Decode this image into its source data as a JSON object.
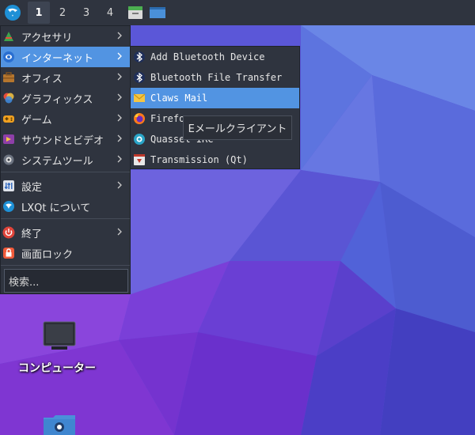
{
  "panel": {
    "start_icon": "lxqt-logo-icon",
    "desktops": [
      "1",
      "2",
      "3",
      "4"
    ],
    "active_desktop": "1",
    "quick_launch": [
      "file-manager-icon",
      "show-desktop-icon"
    ]
  },
  "main_menu": {
    "items": [
      {
        "label": "アクセサリ",
        "icon": "accessories-icon",
        "has_submenu": true
      },
      {
        "label": "インターネット",
        "icon": "internet-icon",
        "has_submenu": true,
        "highlighted": true
      },
      {
        "label": "オフィス",
        "icon": "office-icon",
        "has_submenu": true
      },
      {
        "label": "グラフィックス",
        "icon": "graphics-icon",
        "has_submenu": true
      },
      {
        "label": "ゲーム",
        "icon": "games-icon",
        "has_submenu": true
      },
      {
        "label": "サウンドとビデオ",
        "icon": "sound-video-icon",
        "has_submenu": true
      },
      {
        "label": "システムツール",
        "icon": "system-tools-icon",
        "has_submenu": true
      },
      {
        "label": "設定",
        "icon": "settings-icon",
        "has_submenu": true
      },
      {
        "label": "LXQt について",
        "icon": "lxqt-about-icon",
        "has_submenu": false
      },
      {
        "label": "終了",
        "icon": "power-icon",
        "has_submenu": true
      },
      {
        "label": "画面ロック",
        "icon": "lock-icon",
        "has_submenu": false
      }
    ],
    "search_text": "検索..."
  },
  "internet_submenu": {
    "items": [
      {
        "label": "Add Bluetooth Device",
        "icon": "bluetooth-icon"
      },
      {
        "label": "Bluetooth File Transfer",
        "icon": "bluetooth-icon"
      },
      {
        "label": "Claws Mail",
        "icon": "claws-mail-icon",
        "highlighted": true
      },
      {
        "label": "Firefo",
        "icon": "firefox-icon"
      },
      {
        "label": "Quassel IRC",
        "icon": "quassel-icon"
      },
      {
        "label": "Transmission (Qt)",
        "icon": "transmission-icon"
      }
    ]
  },
  "tooltip": {
    "text": "Eメールクライアント"
  },
  "desktop": {
    "icons": [
      {
        "label": "コンピューター",
        "icon": "computer-icon"
      },
      {
        "label": "",
        "icon": "network-folder-icon"
      }
    ]
  },
  "colors": {
    "panel_bg": "#2f343f",
    "highlight": "#5294e2",
    "wallpaper_base": "#5d4fd6"
  }
}
